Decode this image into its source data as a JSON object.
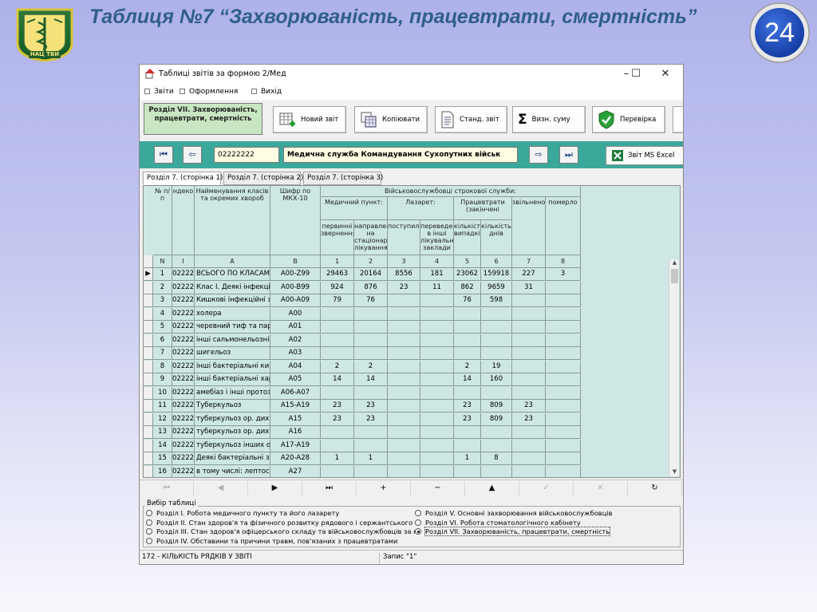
{
  "slide": {
    "title": "Таблиця №7 “Захворюваність, працевтрати, смертність”",
    "page_number": "24",
    "logo_text": "НАЦ ТВИ"
  },
  "window": {
    "title": "Таблиці звітів за формою 2/Мед",
    "min_icon": "minimize-icon",
    "max_icon": "maximize-icon",
    "close_icon": "close-icon"
  },
  "menu": [
    "Звіти",
    "Оформлення",
    "Вихід"
  ],
  "toolbar": {
    "section_label": "Розділ VII. Захворюваність, працевтрати, смертність",
    "new_report": "Новий звіт",
    "copy": "Копіювати",
    "standard_report": "Станд. звіт",
    "define_sum": "Визн. суму",
    "check": "Перевірка"
  },
  "nav": {
    "code": "02222222",
    "organization": "Медична служба Командування Сухопутних військ",
    "excel_button": "Звіт MS Excel"
  },
  "tabs": [
    "Розділ 7. (сторінка 1)",
    "Розділ 7. (сторінка 2)",
    "Розділ 7. (сторінка 3)"
  ],
  "grid": {
    "headers": {
      "num": "№ п/п",
      "code": "ндеко",
      "name": "Найменування класів та окремих хвороб",
      "icd": "Шифр по МКХ-10",
      "group": "Військовослужбовці строкової служби:",
      "med_point": "Медичний пункт:",
      "lazaret": "Лазарет:",
      "work_loss": "Працевтрати (закінчені",
      "released": "звільнено",
      "died": "померло",
      "primary": "первинні звернення",
      "referred": "направлен на стаціонарн лікування",
      "admitted": "поступило",
      "transferred": "переведен в інші лікувальн заклади",
      "cases": "кількість випадків",
      "days": "кількість днів"
    },
    "col_numbers": [
      "N",
      "I",
      "A",
      "B",
      "1",
      "2",
      "3",
      "4",
      "5",
      "6",
      "7",
      "8"
    ],
    "current_row_marker": "▶",
    "rows": [
      [
        "1",
        "02222",
        "ВСЬОГО ПО КЛАСАМ",
        "A00-Z99",
        "29463",
        "20164",
        "8556",
        "181",
        "23062",
        "159918",
        "227",
        "3"
      ],
      [
        "2",
        "02222",
        "Клас I. Деякі інфекційн",
        "A00-B99",
        "924",
        "876",
        "23",
        "11",
        "862",
        "9659",
        "31",
        ""
      ],
      [
        "3",
        "02222",
        "Кишкові інфекційні хв",
        "A00-A09",
        "79",
        "76",
        "",
        "",
        "76",
        "598",
        "",
        ""
      ],
      [
        "4",
        "02222",
        "холера",
        "A00",
        "",
        "",
        "",
        "",
        "",
        "",
        "",
        ""
      ],
      [
        "5",
        "02222",
        "черевний тиф та пара",
        "A01",
        "",
        "",
        "",
        "",
        "",
        "",
        "",
        ""
      ],
      [
        "6",
        "02222",
        "інші сальмонельозні і",
        "A02",
        "",
        "",
        "",
        "",
        "",
        "",
        "",
        ""
      ],
      [
        "7",
        "02222",
        "шигельоз",
        "A03",
        "",
        "",
        "",
        "",
        "",
        "",
        "",
        ""
      ],
      [
        "8",
        "02222",
        "інші бактеріальні киш",
        "A04",
        "2",
        "2",
        "",
        "",
        "2",
        "19",
        "",
        ""
      ],
      [
        "9",
        "02222",
        "інші бактеріальні харч",
        "A05",
        "14",
        "14",
        "",
        "",
        "14",
        "160",
        "",
        ""
      ],
      [
        "10",
        "02222",
        "амебіаз і інші протозо",
        "A06-A07",
        "",
        "",
        "",
        "",
        "",
        "",
        "",
        ""
      ],
      [
        "11",
        "02222",
        "Туберкульоз",
        "A15-A19",
        "23",
        "23",
        "",
        "",
        "23",
        "809",
        "23",
        ""
      ],
      [
        "12",
        "02222",
        "туберкульоз ор. дих.,",
        "A15",
        "23",
        "23",
        "",
        "",
        "23",
        "809",
        "23",
        ""
      ],
      [
        "13",
        "02222",
        "туберкульоз ор. дих.,",
        "A16",
        "",
        "",
        "",
        "",
        "",
        "",
        "",
        ""
      ],
      [
        "14",
        "02222",
        "туберкульоз інших ор",
        "A17-A19",
        "",
        "",
        "",
        "",
        "",
        "",
        "",
        ""
      ],
      [
        "15",
        "02222",
        "Деякі бактеріальні зо",
        "A20-A28",
        "1",
        "1",
        "",
        "",
        "1",
        "8",
        "",
        ""
      ],
      [
        "16",
        "02222",
        "в тому числі: лептосп",
        "A27",
        "",
        "",
        "",
        "",
        "",
        "",
        "",
        ""
      ]
    ]
  },
  "pager": [
    "⏮",
    "◀",
    "▶",
    "⏭",
    "+",
    "−",
    "▲",
    "✓",
    "✕",
    "↻"
  ],
  "table_choice": {
    "label": "Вибір таблиці",
    "options_left": [
      "Розділ I. Робота медичного пункту та його лазарету",
      "Розділ II. Стан здоров'я та фізичного розвитку рядового і сержантського с",
      "Розділ III. Стан здоров'я офіцерського складу та військовослужбовців за к",
      "Розділ IV. Обставини та причини травм, пов'язаних з працевтратами"
    ],
    "options_right": [
      "Розділ V. Основні захворювання військовослужбовців",
      "Розділ VI. Робота стоматологічного кабінету",
      "Розділ VII. Захворюваність, працевтрати, смертність"
    ],
    "selected": "Розділ VII. Захворюваність, працевтрати, смертність"
  },
  "status": {
    "rows_count": "172 - КІЛЬКІСТЬ РЯДКІВ У ЗВІТІ",
    "record": "Запис \"1\""
  },
  "colors": {
    "nav_band": "#3aa89b",
    "grid_bg": "#cde7e4",
    "section_box": "#c7e6c1",
    "title_text": "#2f5f8a",
    "badge": "#1d45b8"
  }
}
